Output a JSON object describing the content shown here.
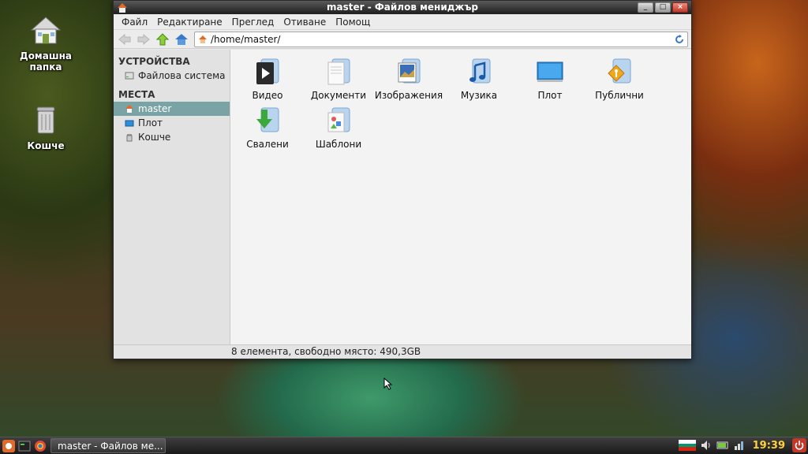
{
  "desktop": {
    "icons": [
      {
        "label": "Домашна папка",
        "icon": "home-folder-icon"
      },
      {
        "label": "Кошче",
        "icon": "trash-icon"
      }
    ]
  },
  "window": {
    "title": "master - Файлов мениджър",
    "menu": [
      "Файл",
      "Редактиране",
      "Преглед",
      "Отиване",
      "Помощ"
    ],
    "location": "/home/master/",
    "sidebar": {
      "devices_header": "УСТРОЙСТВА",
      "devices": [
        {
          "label": "Файлова система",
          "icon": "drive-icon"
        }
      ],
      "places_header": "МЕСТА",
      "places": [
        {
          "label": "master",
          "icon": "home-icon",
          "selected": true
        },
        {
          "label": "Плот",
          "icon": "desktop-icon"
        },
        {
          "label": "Кошче",
          "icon": "trash-icon"
        }
      ]
    },
    "files": [
      {
        "label": "Видео",
        "icon": "video-folder-icon"
      },
      {
        "label": "Документи",
        "icon": "documents-folder-icon"
      },
      {
        "label": "Изображения",
        "icon": "pictures-folder-icon"
      },
      {
        "label": "Музика",
        "icon": "music-folder-icon"
      },
      {
        "label": "Плот",
        "icon": "desktop-folder-icon"
      },
      {
        "label": "Публични",
        "icon": "public-folder-icon"
      },
      {
        "label": "Свалени",
        "icon": "downloads-folder-icon"
      },
      {
        "label": "Шаблони",
        "icon": "templates-folder-icon"
      }
    ],
    "status": "8 елемента, свободно място: 490,3GB"
  },
  "taskbar": {
    "task_label": "master - Файлов ме...",
    "clock": "19:39"
  },
  "colors": {
    "selection": "#7aa3a6",
    "clock": "#ffd23a",
    "folder": "#9cc3e6"
  }
}
